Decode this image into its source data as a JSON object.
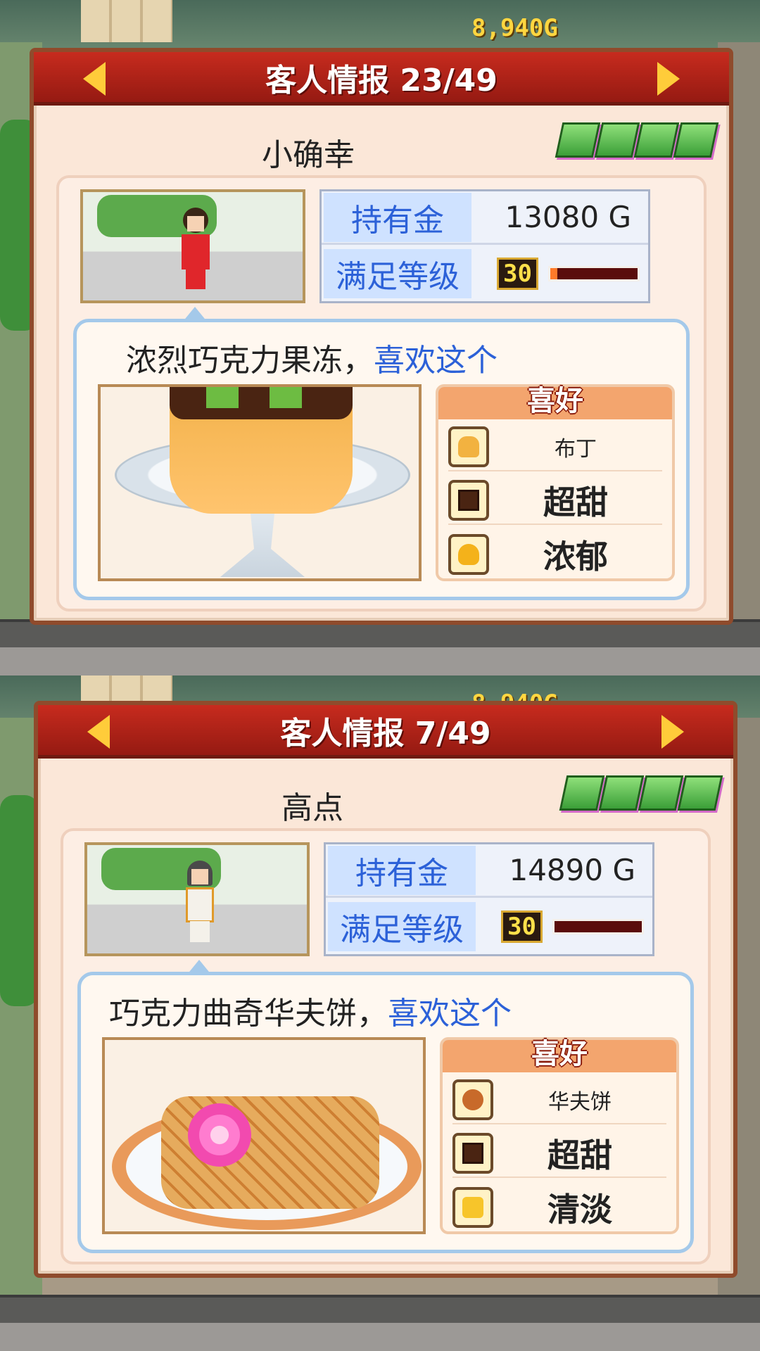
{
  "screens": [
    {
      "hud_money": "8,940G",
      "title": "客人情报 23/49",
      "customer_name": "小确幸",
      "stats": {
        "money_label": "持有金",
        "money_value": "13080 G",
        "satisfaction_label": "满足等级",
        "satisfaction_level": "30",
        "satisfaction_progress": 0.08
      },
      "speech": {
        "text": "浓烈巧克力果冻，",
        "highlight": "喜欢这个"
      },
      "prefs_title": "喜好",
      "prefs": [
        {
          "icon": "pudding-icon",
          "label": "布丁",
          "size": "small"
        },
        {
          "icon": "chocolate-icon",
          "label": "超甜",
          "size": "big"
        },
        {
          "icon": "rich-icon",
          "label": "浓郁",
          "size": "big"
        }
      ],
      "dish": "pudding",
      "outfit_color": "#e0262b",
      "rank_count": 4
    },
    {
      "hud_money": "8,940G",
      "title": "客人情报 7/49",
      "customer_name": "高点",
      "stats": {
        "money_label": "持有金",
        "money_value": "14890 G",
        "satisfaction_label": "满足等级",
        "satisfaction_level": "30",
        "satisfaction_progress": 0.0
      },
      "speech": {
        "text": "巧克力曲奇华夫饼，",
        "highlight": "喜欢这个"
      },
      "prefs_title": "喜好",
      "prefs": [
        {
          "icon": "waffle-icon",
          "label": "华夫饼",
          "size": "small"
        },
        {
          "icon": "chocolate-icon",
          "label": "超甜",
          "size": "big"
        },
        {
          "icon": "light-icon",
          "label": "清淡",
          "size": "big"
        }
      ],
      "dish": "waffle",
      "outfit_color": "#f4f1ea",
      "rank_count": 4
    }
  ]
}
